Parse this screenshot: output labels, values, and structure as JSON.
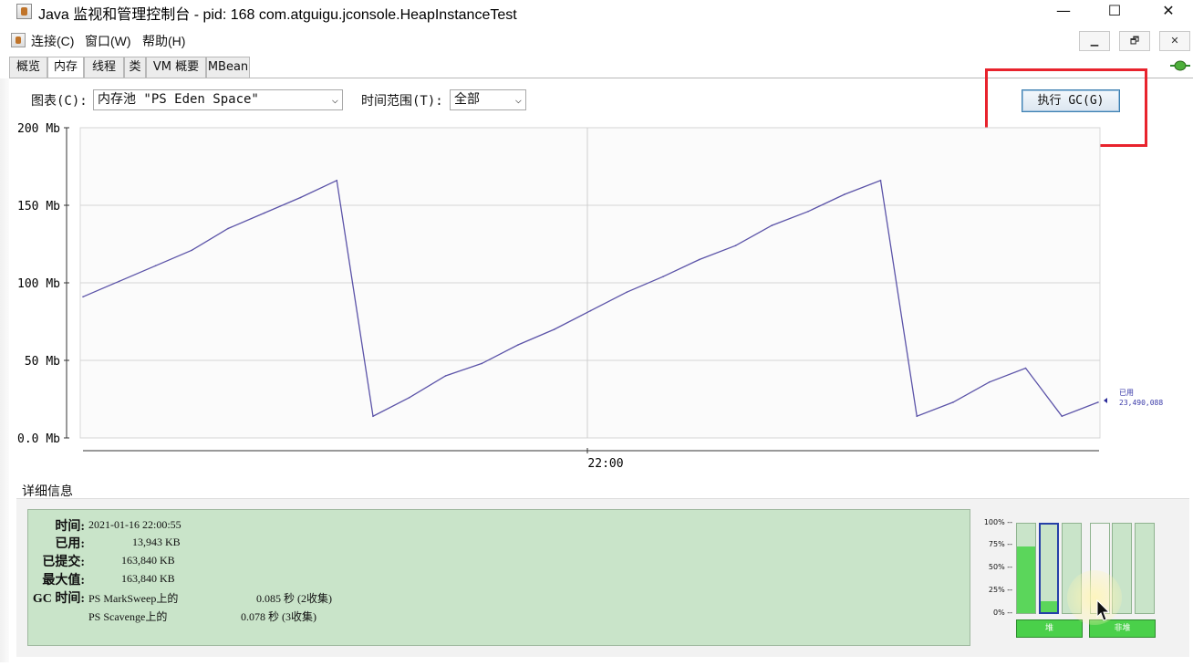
{
  "window": {
    "title": "Java 监视和管理控制台 - pid: 168 com.atguigu.jconsole.HeapInstanceTest",
    "minimize": "—",
    "maximize": "☐",
    "close": "✕"
  },
  "menu": {
    "items": [
      "连接(C)",
      "窗口(W)",
      "帮助(H)"
    ],
    "mdi": [
      "▁",
      "🗗",
      "✕"
    ]
  },
  "tabs": [
    "概览",
    "内存",
    "线程",
    "类",
    "VM 概要",
    "MBean"
  ],
  "toolbar": {
    "chart_label": "图表(C):",
    "chart_value": "内存池 \"PS Eden Space\"",
    "range_label": "时间范围(T):",
    "range_value": "全部",
    "gc_button": "执行 GC(G)"
  },
  "chart_data": {
    "type": "line",
    "ylim": [
      0,
      200
    ],
    "yticks": [
      "200 Mb",
      "150 Mb",
      "100 Mb",
      "50 Mb",
      "0.0 Mb"
    ],
    "xtick": "22:00",
    "line_color": "#5b53a8",
    "series": [
      {
        "name": "已用",
        "values": [
          91,
          101,
          111,
          121,
          135,
          145,
          155,
          166,
          14,
          26,
          40,
          48,
          60,
          70,
          82,
          94,
          104,
          115,
          124,
          137,
          146,
          157,
          166,
          14,
          23,
          36,
          45,
          14,
          23
        ]
      }
    ],
    "legend_label": "已用",
    "legend_value": "23,490,088"
  },
  "details": {
    "title": "详细信息",
    "time_key": "时间:",
    "time_val": "2021-01-16 22:00:55",
    "used_key": "已用:",
    "used_val": "13,943 KB",
    "committed_key": "已提交:",
    "committed_val": "163,840 KB",
    "max_key": "最大值:",
    "max_val": "163,840 KB",
    "gc_key": "GC 时间:",
    "gc1_name": "PS MarkSweep上的",
    "gc1_val": "0.085 秒 (2收集)",
    "gc2_name": "PS Scavenge上的",
    "gc2_val": "0.078 秒 (3收集)"
  },
  "pools": {
    "axis": [
      "100% --",
      "75% --",
      "50% --",
      "25% --",
      "0% --"
    ],
    "bars": [
      {
        "usage": 0.74,
        "selected": false
      },
      {
        "usage": 0.13,
        "selected": true
      },
      {
        "usage": 0.0,
        "selected": false
      },
      {
        "usage": 0.0,
        "selected": false
      },
      {
        "usage": 0.0,
        "selected": false
      },
      {
        "usage": 0.0,
        "selected": false
      }
    ],
    "heap_label": "堆",
    "nonheap_label": "非堆"
  }
}
